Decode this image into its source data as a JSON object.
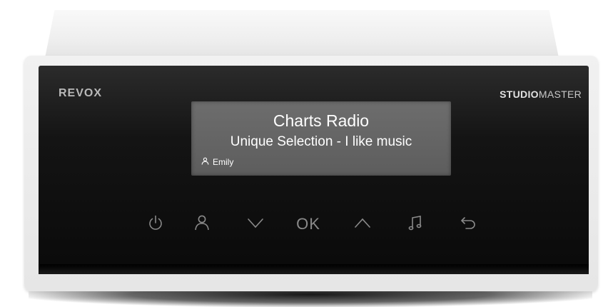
{
  "device": {
    "brand": "REVOX",
    "model_bold": "STUDIO",
    "model_light": "MASTER"
  },
  "display": {
    "station": "Charts Radio",
    "track": "Unique Selection - I like music",
    "profile_name": "Emily"
  },
  "controls": {
    "ok_label": "OK",
    "icons": [
      "power-icon",
      "user-icon",
      "chevron-down-icon",
      "ok-button",
      "chevron-up-icon",
      "music-note-icon",
      "back-arrow-icon"
    ]
  },
  "colors": {
    "faceplate": "#141414",
    "display_bg": "#636363",
    "display_text": "#ffffff",
    "control_icons": "#8a8a8a",
    "cabinet": "#eaeaea"
  }
}
